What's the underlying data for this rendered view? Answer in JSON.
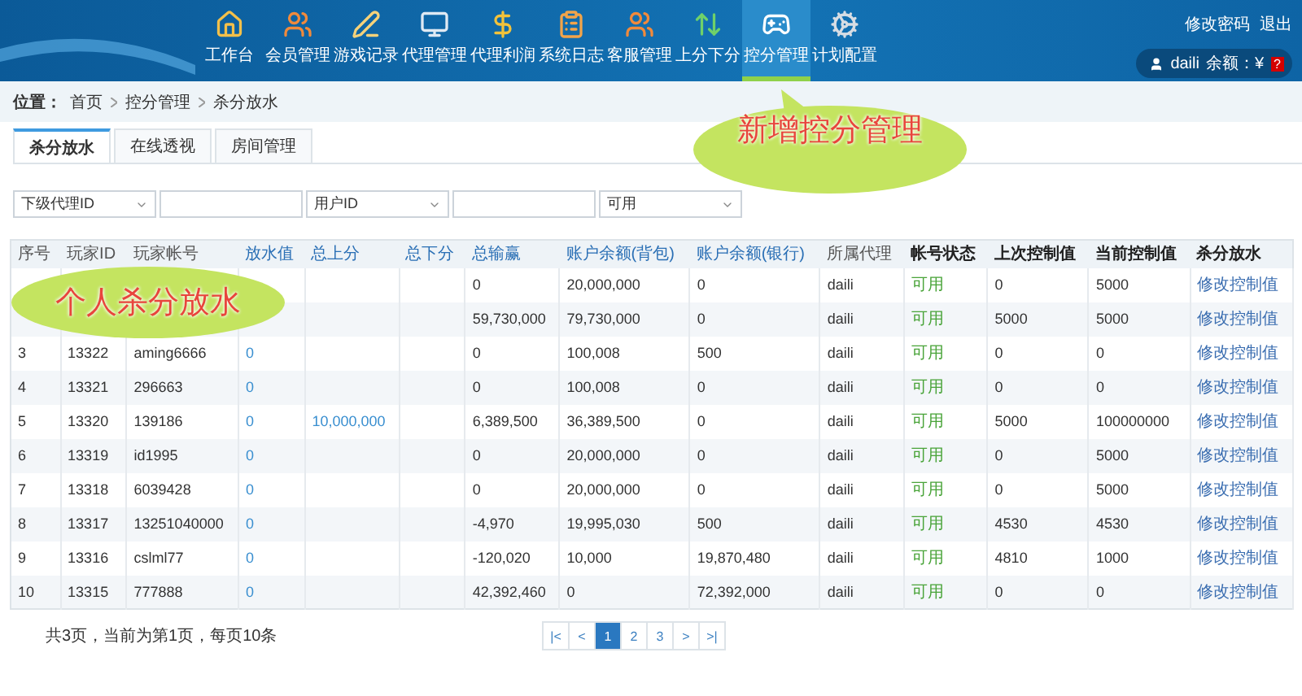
{
  "header": {
    "nav": [
      {
        "label": "工作台",
        "selected": false
      },
      {
        "label": "会员管理",
        "selected": false
      },
      {
        "label": "游戏记录",
        "selected": false
      },
      {
        "label": "代理管理",
        "selected": false
      },
      {
        "label": "代理利润",
        "selected": false
      },
      {
        "label": "系统日志",
        "selected": false
      },
      {
        "label": "客服管理",
        "selected": false
      },
      {
        "label": "上分下分",
        "selected": false
      },
      {
        "label": "控分管理",
        "selected": true
      },
      {
        "label": "计划配置",
        "selected": false
      }
    ],
    "links": [
      "修改密码",
      "退出"
    ],
    "user": {
      "name": "daili",
      "balance_label": "余额：¥",
      "badge": "?"
    }
  },
  "breadcrumb": {
    "label": "位置：",
    "items": [
      "首页",
      "控分管理",
      "杀分放水"
    ]
  },
  "tabs": [
    {
      "label": "杀分放水",
      "selected": true
    },
    {
      "label": "在线透视",
      "selected": false
    },
    {
      "label": "房间管理",
      "selected": false
    }
  ],
  "filters": [
    {
      "kind": "select",
      "value": "下级代理ID"
    },
    {
      "kind": "input"
    },
    {
      "kind": "select",
      "value": "用户ID"
    },
    {
      "kind": "input"
    },
    {
      "kind": "select",
      "value": "可用"
    }
  ],
  "table": {
    "columns": [
      {
        "label": "序号",
        "kind": "plain"
      },
      {
        "label": "玩家ID",
        "kind": "plain"
      },
      {
        "label": "玩家帐号",
        "kind": "plain"
      },
      {
        "label": "放水值",
        "kind": "value"
      },
      {
        "label": "总上分",
        "kind": "value"
      },
      {
        "label": "总下分",
        "kind": "amount"
      },
      {
        "label": "总输赢",
        "kind": "amount"
      },
      {
        "label": "账户余额(背包)",
        "kind": "amount"
      },
      {
        "label": "账户余额(银行)",
        "kind": "amount"
      },
      {
        "label": "所属代理",
        "kind": "plain"
      },
      {
        "label": "帐号状态",
        "kind": "status"
      },
      {
        "label": "上次控制值",
        "kind": "bold"
      },
      {
        "label": "当前控制值",
        "kind": "bold"
      },
      {
        "label": "杀分放水",
        "kind": "action"
      }
    ],
    "rows": [
      [
        null,
        null,
        null,
        null,
        null,
        null,
        "0",
        "20,000,000",
        "0",
        "daili",
        "可用",
        "0",
        "5000",
        "修改控制值"
      ],
      [
        null,
        null,
        null,
        null,
        null,
        null,
        "59,730,000",
        "79,730,000",
        "0",
        "daili",
        "可用",
        "5000",
        "5000",
        "修改控制值"
      ],
      [
        "3",
        "13322",
        "aming6666",
        "0",
        null,
        null,
        "0",
        "100,008",
        "500",
        "daili",
        "可用",
        "0",
        "0",
        "修改控制值"
      ],
      [
        "4",
        "13321",
        "296663",
        "0",
        null,
        null,
        "0",
        "100,008",
        "0",
        "daili",
        "可用",
        "0",
        "0",
        "修改控制值"
      ],
      [
        "5",
        "13320",
        "139186",
        "0",
        "10,000,000",
        null,
        "6,389,500",
        "36,389,500",
        "0",
        "daili",
        "可用",
        "5000",
        "100000000",
        "修改控制值"
      ],
      [
        "6",
        "13319",
        "id1995",
        "0",
        null,
        null,
        "0",
        "20,000,000",
        "0",
        "daili",
        "可用",
        "0",
        "5000",
        "修改控制值"
      ],
      [
        "7",
        "13318",
        "6039428",
        "0",
        null,
        null,
        "0",
        "20,000,000",
        "0",
        "daili",
        "可用",
        "0",
        "5000",
        "修改控制值"
      ],
      [
        "8",
        "13317",
        "13251040000",
        "0",
        null,
        null,
        "-4,970",
        "19,995,030",
        "500",
        "daili",
        "可用",
        "4530",
        "4530",
        "修改控制值"
      ],
      [
        "9",
        "13316",
        "cslml77",
        "0",
        null,
        null,
        "-120,020",
        "10,000",
        "19,870,480",
        "daili",
        "可用",
        "4810",
        "1000",
        "修改控制值"
      ],
      [
        "10",
        "13315",
        "777888",
        "0",
        null,
        null,
        "42,392,460",
        "0",
        "72,392,000",
        "daili",
        "可用",
        "0",
        "0",
        "修改控制值"
      ]
    ]
  },
  "pager": {
    "summary": "共3页，当前为第1页，每页10条",
    "buttons": [
      {
        "label": "|<",
        "selected": false
      },
      {
        "label": "<",
        "selected": false
      },
      {
        "label": "1",
        "selected": true
      },
      {
        "label": "2",
        "selected": false
      },
      {
        "label": "3",
        "selected": false
      },
      {
        "label": ">",
        "selected": false
      },
      {
        "label": ">|",
        "selected": false
      }
    ]
  },
  "callouts": [
    "新增控分管理",
    "个人杀分放水"
  ]
}
